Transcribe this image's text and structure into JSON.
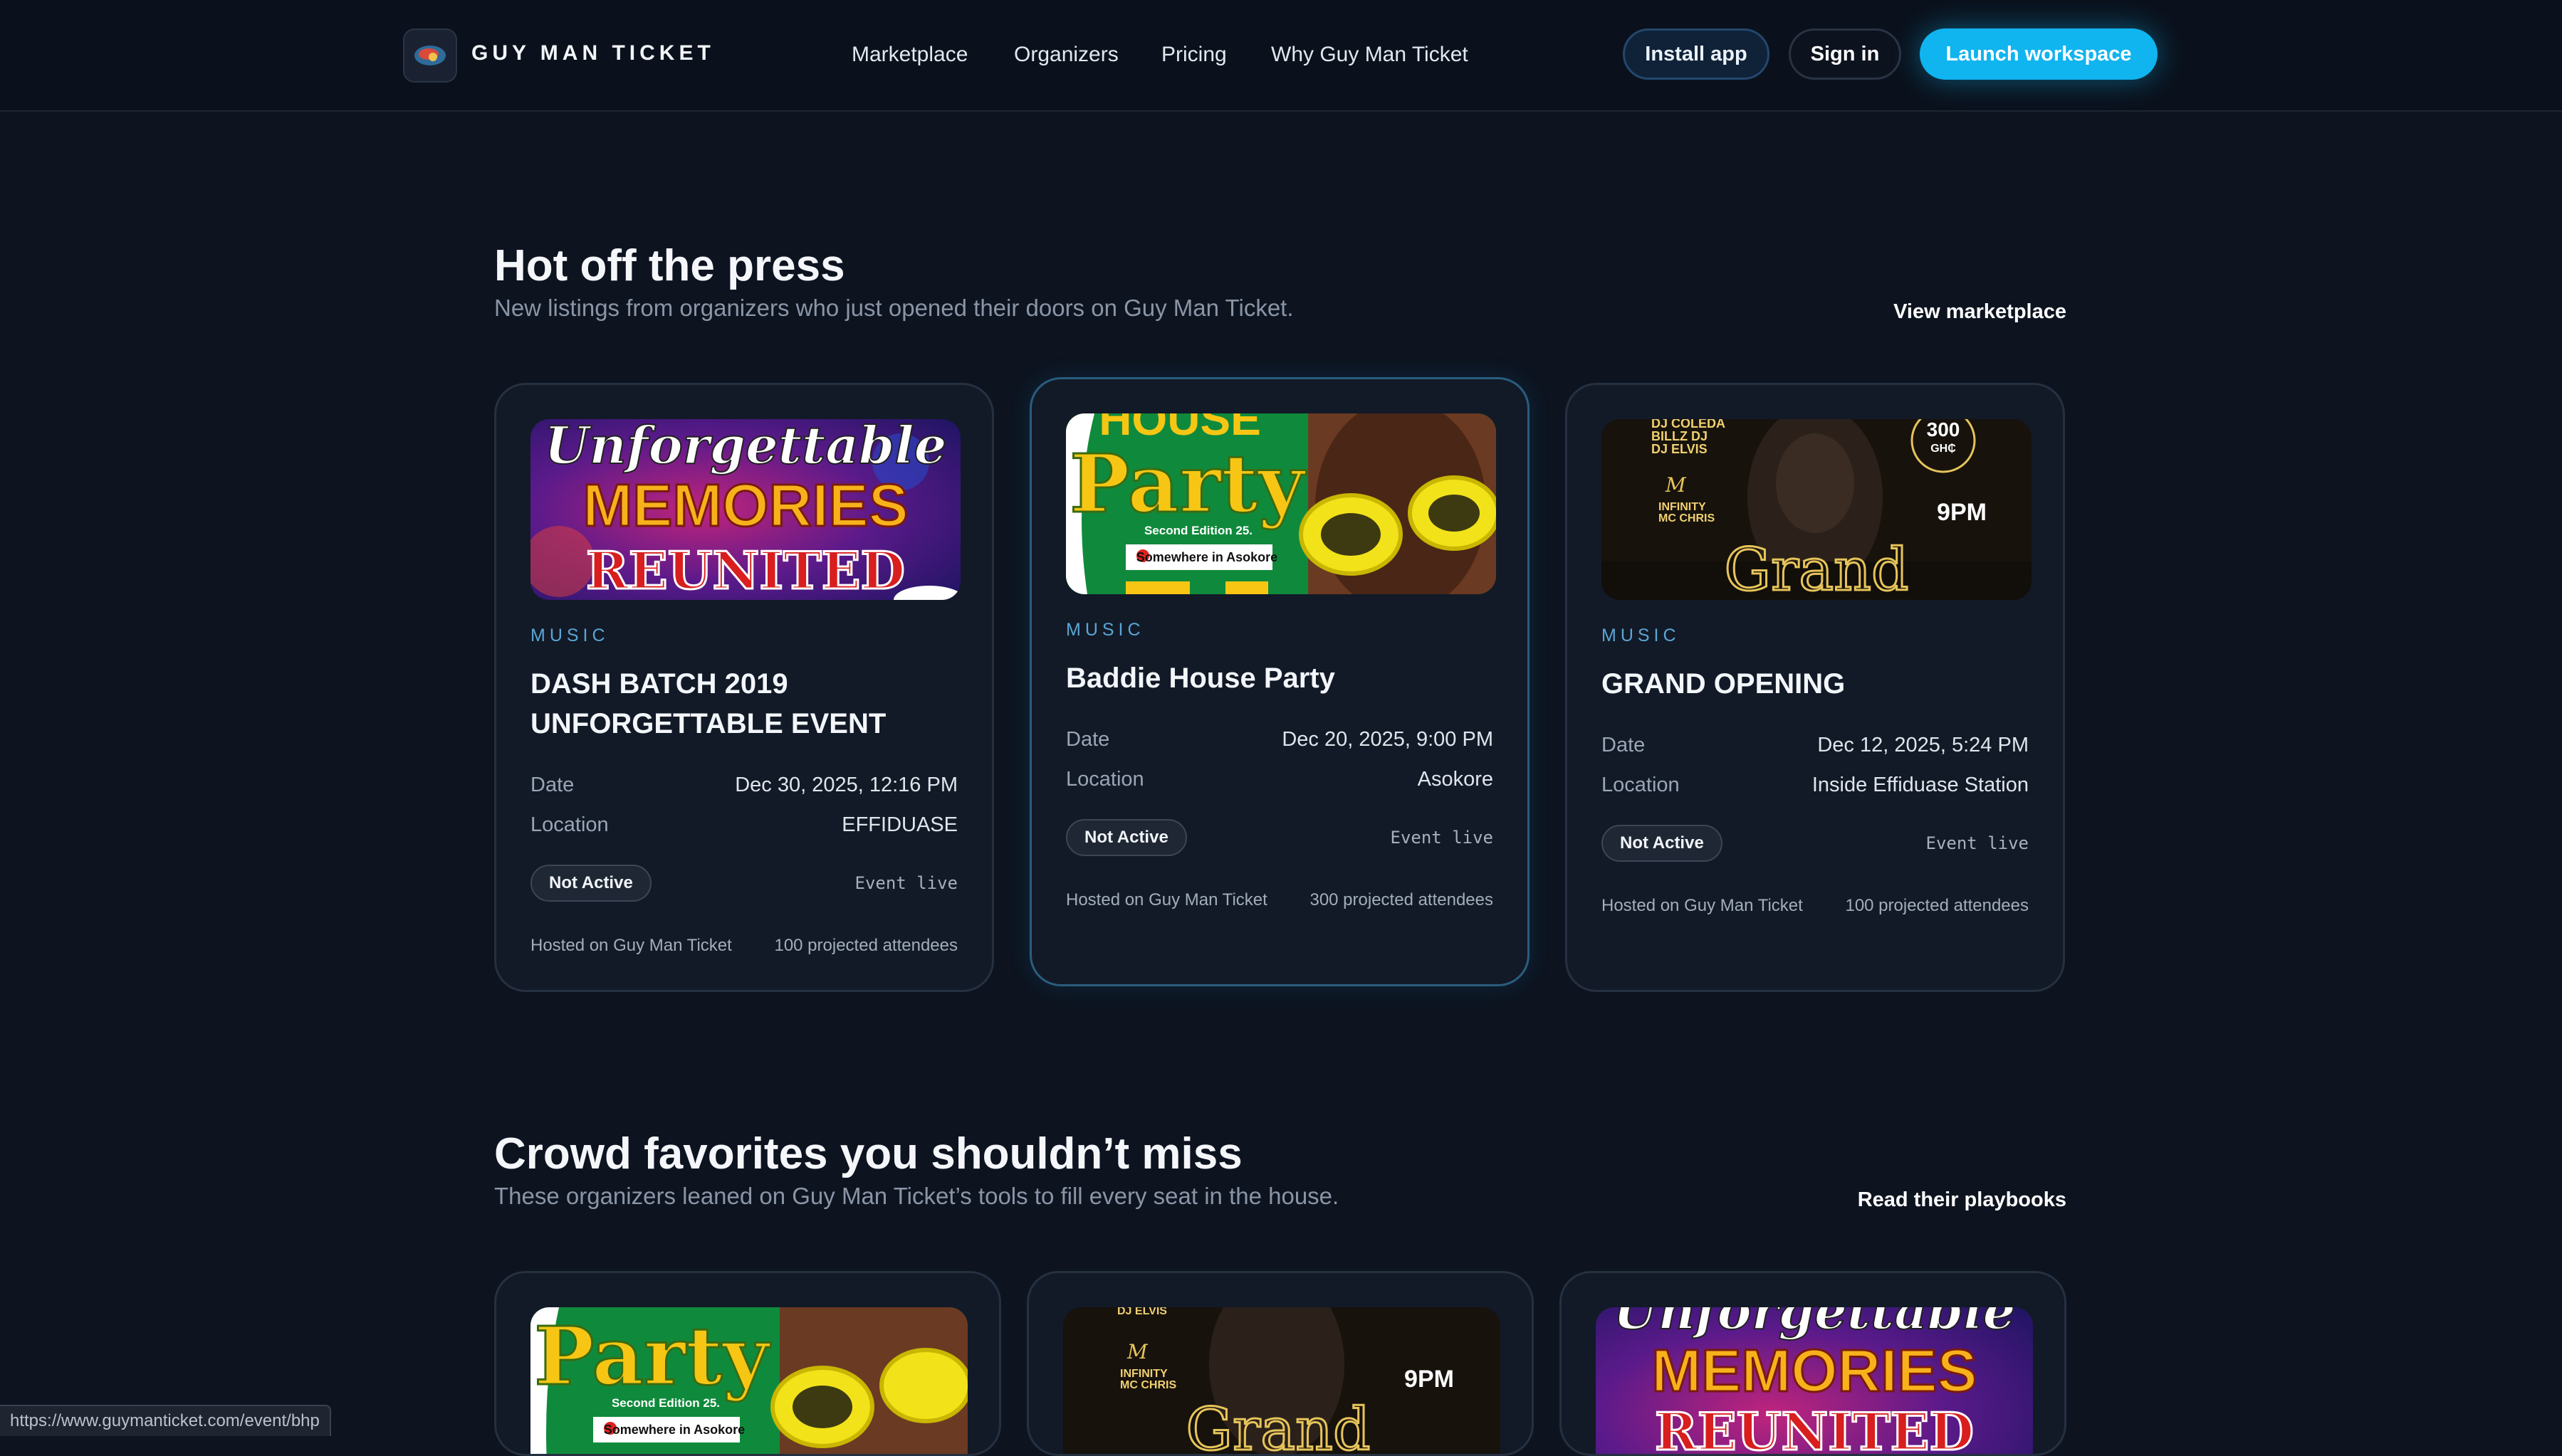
{
  "header": {
    "brand": "GUY MAN TICKET",
    "nav": [
      "Marketplace",
      "Organizers",
      "Pricing",
      "Why Guy Man Ticket"
    ],
    "install_label": "Install app",
    "signin_label": "Sign in",
    "launch_label": "Launch workspace"
  },
  "hot": {
    "title": "Hot off the press",
    "subtitle": "New listings from organizers who just opened their doors on Guy Man Ticket.",
    "link": "View marketplace",
    "cards": [
      {
        "category": "MUSIC",
        "title": "DASH BATCH 2019 UNFORGETTABLE EVENT",
        "date_label": "Date",
        "date": "Dec 30, 2025, 12:16 PM",
        "location_label": "Location",
        "location": "EFFIDUASE",
        "status": "Not Active",
        "live": "Event live",
        "hosted": "Hosted on Guy Man Ticket",
        "attendees": "100 projected attendees",
        "poster": {
          "line1": "Unforgettable",
          "line2": "MEMORIES",
          "line3": "REUNITED"
        }
      },
      {
        "category": "MUSIC",
        "title": "Baddie House Party",
        "date_label": "Date",
        "date": "Dec 20, 2025, 9:00 PM",
        "location_label": "Location",
        "location": "Asokore",
        "status": "Not Active",
        "live": "Event live",
        "hosted": "Hosted on Guy Man Ticket",
        "attendees": "300 projected attendees",
        "poster": {
          "line1": "HOUSE",
          "line2": "Party",
          "line3": "Second Edition 25.",
          "line4": "Somewhere in Asokore"
        }
      },
      {
        "category": "MUSIC",
        "title": "GRAND OPENING",
        "date_label": "Date",
        "date": "Dec 12, 2025, 5:24 PM",
        "location_label": "Location",
        "location": "Inside Effiduase Station",
        "status": "Not Active",
        "live": "Event live",
        "hosted": "Hosted on Guy Man Ticket",
        "attendees": "100 projected attendees",
        "poster": {
          "djs": "DJ COLEDA\nBILLZ DJ\nDJ ELVIS",
          "mcs": "INFINITY\nMC CHRIS",
          "price": "300",
          "currency": "GH₵",
          "time": "9PM",
          "word": "Grand"
        }
      }
    ]
  },
  "crowd": {
    "title": "Crowd favorites you shouldn’t miss",
    "subtitle": "These organizers leaned on Guy Man Ticket’s tools to fill every seat in the house.",
    "link": "Read their playbooks",
    "posters": [
      {
        "line1": "Party",
        "line2": "Second Edition 25.",
        "line3": "Somewhere in Asokore"
      },
      {
        "dj": "DJ ELVIS",
        "mcs": "INFINITY\nMC CHRIS",
        "time": "9PM",
        "word": "Grand"
      },
      {
        "line1": "Unforgettable",
        "line2": "MEMORIES",
        "line3": "REUNITED"
      }
    ]
  },
  "status_bar": {
    "url": "https://www.guymanticket.com/event/bhp"
  },
  "colors": {
    "background": "#0d1420",
    "accent": "#10b4ef",
    "category": "#5aa6d4"
  }
}
